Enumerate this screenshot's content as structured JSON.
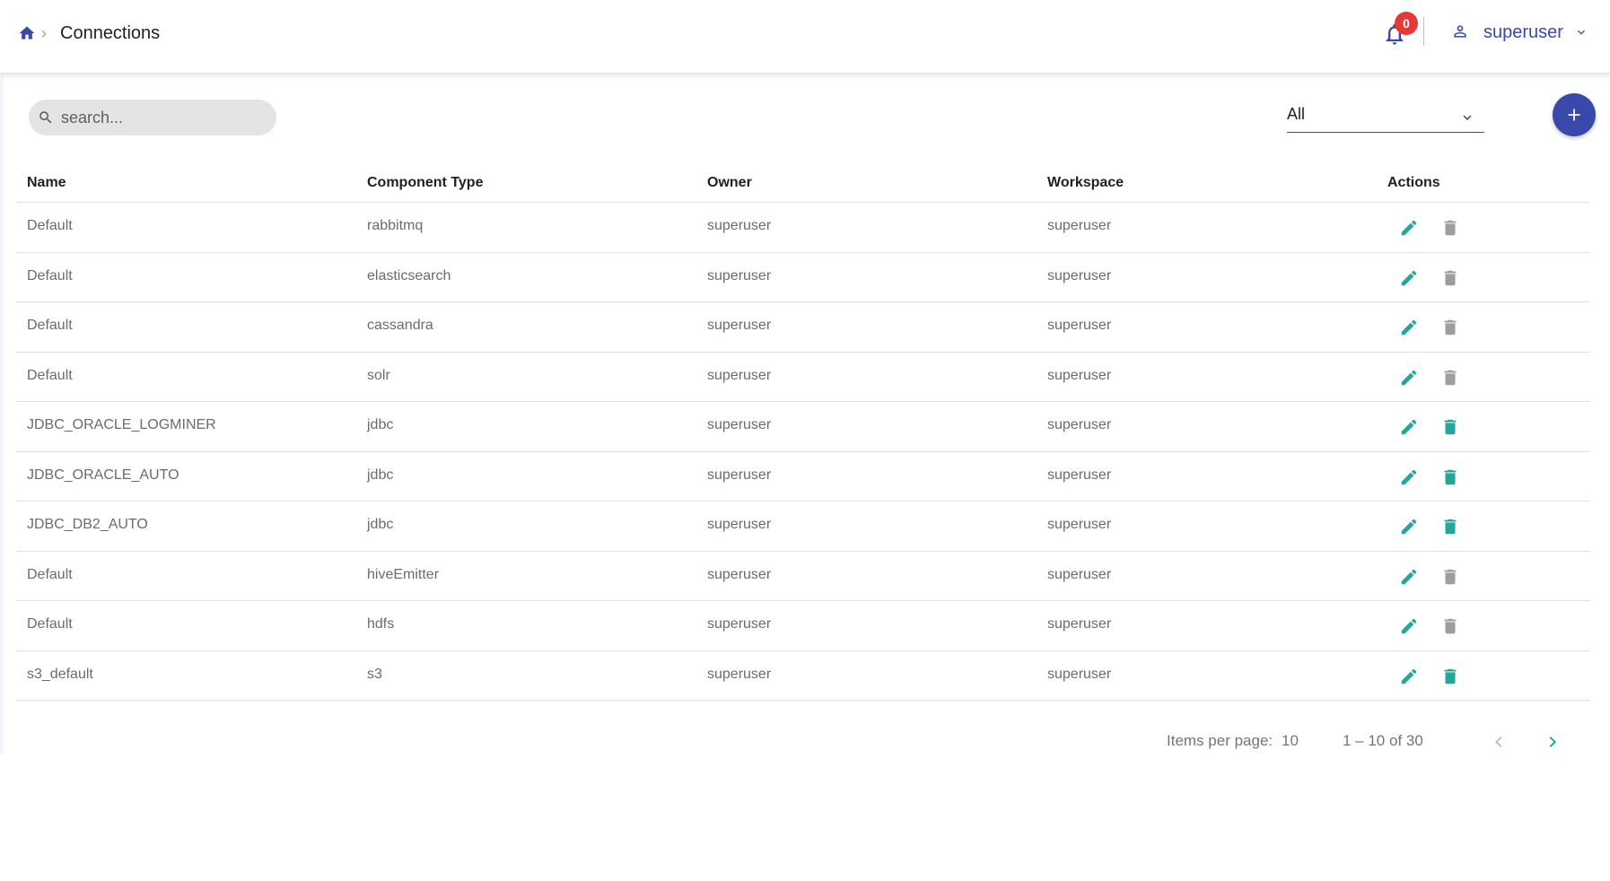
{
  "breadcrumb": {
    "title": "Connections"
  },
  "header": {
    "notification_count": "0",
    "user_name": "superuser"
  },
  "search": {
    "placeholder": "search..."
  },
  "filter": {
    "selected": "All"
  },
  "table": {
    "columns": [
      "Name",
      "Component Type",
      "Owner",
      "Workspace",
      "Actions"
    ],
    "rows": [
      {
        "name": "Default",
        "type": "rabbitmq",
        "owner": "superuser",
        "workspace": "superuser",
        "delete_enabled": false
      },
      {
        "name": "Default",
        "type": "elasticsearch",
        "owner": "superuser",
        "workspace": "superuser",
        "delete_enabled": false
      },
      {
        "name": "Default",
        "type": "cassandra",
        "owner": "superuser",
        "workspace": "superuser",
        "delete_enabled": false
      },
      {
        "name": "Default",
        "type": "solr",
        "owner": "superuser",
        "workspace": "superuser",
        "delete_enabled": false
      },
      {
        "name": "JDBC_ORACLE_LOGMINER",
        "type": "jdbc",
        "owner": "superuser",
        "workspace": "superuser",
        "delete_enabled": true
      },
      {
        "name": "JDBC_ORACLE_AUTO",
        "type": "jdbc",
        "owner": "superuser",
        "workspace": "superuser",
        "delete_enabled": true
      },
      {
        "name": "JDBC_DB2_AUTO",
        "type": "jdbc",
        "owner": "superuser",
        "workspace": "superuser",
        "delete_enabled": true
      },
      {
        "name": "Default",
        "type": "hiveEmitter",
        "owner": "superuser",
        "workspace": "superuser",
        "delete_enabled": false
      },
      {
        "name": "Default",
        "type": "hdfs",
        "owner": "superuser",
        "workspace": "superuser",
        "delete_enabled": false
      },
      {
        "name": "s3_default",
        "type": "s3",
        "owner": "superuser",
        "workspace": "superuser",
        "delete_enabled": true
      }
    ]
  },
  "paginator": {
    "items_per_page_label": "Items per page:",
    "page_size": "10",
    "range": "1 – 10 of 30"
  },
  "colors": {
    "primary": "#3949ab",
    "action_teal": "#26a69a",
    "disabled_gray": "#9e9e9e",
    "badge_red": "#e53935"
  },
  "icons": {
    "home": "home-icon",
    "notifications": "bell-icon",
    "user": "person-icon",
    "search": "search-icon",
    "add": "plus-icon",
    "edit": "pencil-icon",
    "delete": "trash-icon",
    "prev": "chevron-left-icon",
    "next": "chevron-right-icon"
  }
}
